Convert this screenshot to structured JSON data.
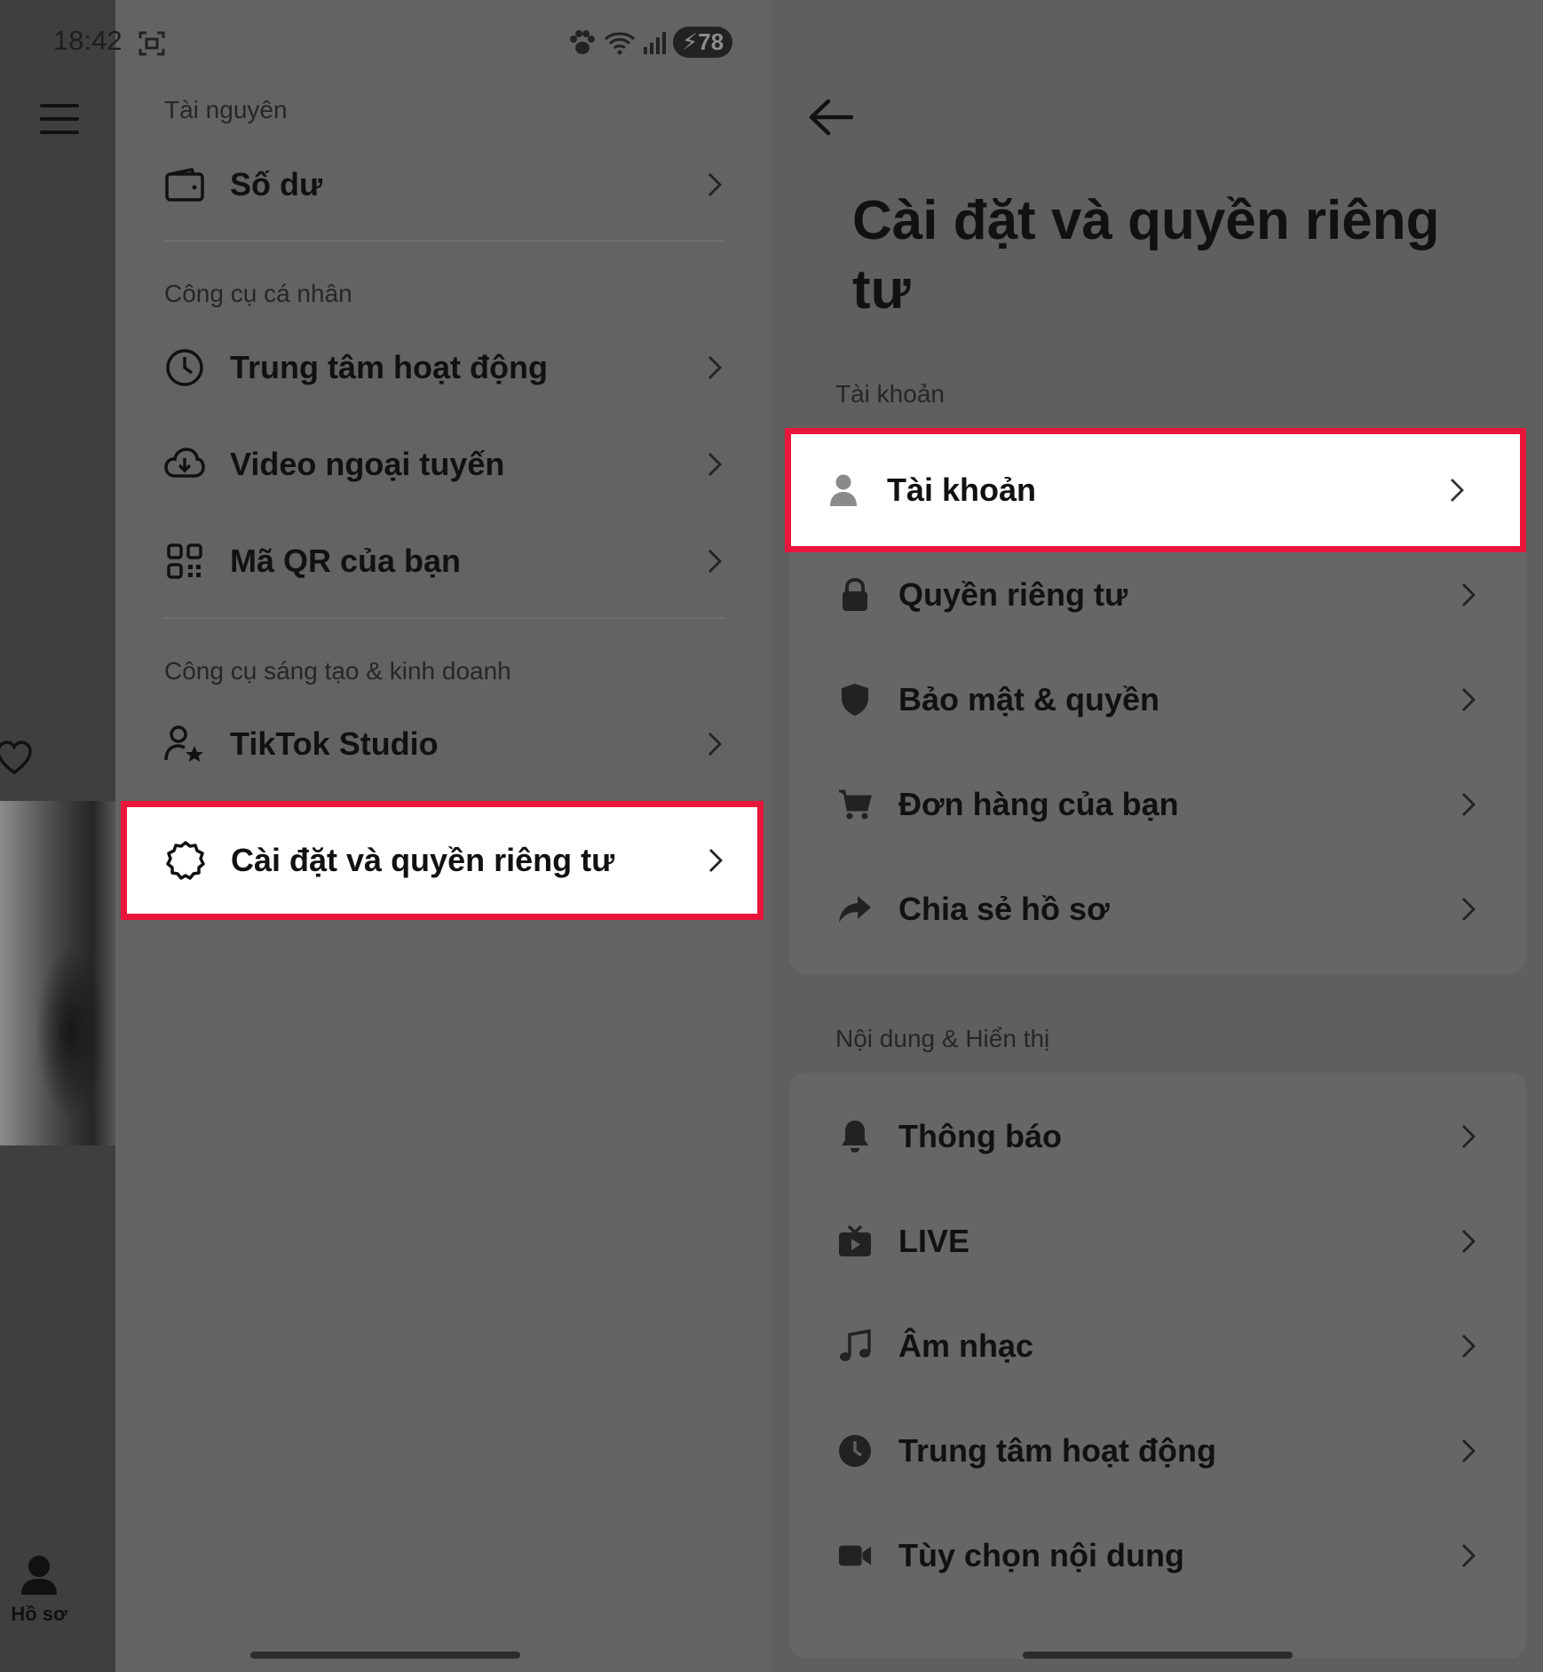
{
  "status_bar": {
    "time": "18:42",
    "battery": "78"
  },
  "left_screen": {
    "bottom_nav": {
      "profile_label": "Hồ sơ"
    },
    "sections": [
      {
        "header": "Tài nguyên",
        "items": [
          {
            "label": "Số dư",
            "icon": "wallet-icon"
          }
        ]
      },
      {
        "header": "Công cụ cá nhân",
        "items": [
          {
            "label": "Trung tâm hoạt động",
            "icon": "clock-icon"
          },
          {
            "label": "Video ngoại tuyến",
            "icon": "cloud-download-icon"
          },
          {
            "label": "Mã QR của bạn",
            "icon": "qr-code-icon"
          }
        ]
      },
      {
        "header": "Công cụ sáng tạo & kinh doanh",
        "items": [
          {
            "label": "TikTok Studio",
            "icon": "user-star-icon"
          },
          {
            "label": "Cài đặt và quyền riêng tư",
            "icon": "gear-icon"
          }
        ]
      }
    ]
  },
  "right_screen": {
    "title": "Cài đặt và quyền riêng tư",
    "sections": [
      {
        "header": "Tài khoản",
        "items": [
          {
            "label": "Tài khoản",
            "icon": "person-icon"
          },
          {
            "label": "Quyền riêng tư",
            "icon": "lock-icon"
          },
          {
            "label": "Bảo mật & quyền",
            "icon": "shield-icon"
          },
          {
            "label": "Đơn hàng của bạn",
            "icon": "cart-icon"
          },
          {
            "label": "Chia sẻ hồ sơ",
            "icon": "share-icon"
          }
        ]
      },
      {
        "header": "Nội dung & Hiển thị",
        "items": [
          {
            "label": "Thông báo",
            "icon": "bell-icon"
          },
          {
            "label": "LIVE",
            "icon": "tv-icon"
          },
          {
            "label": "Âm nhạc",
            "icon": "music-icon"
          },
          {
            "label": "Trung tâm hoạt động",
            "icon": "clock-icon"
          },
          {
            "label": "Tùy chọn nội dung",
            "icon": "video-camera-icon"
          }
        ]
      }
    ]
  },
  "colors": {
    "highlight_border": "#e8163a",
    "overlay_gray": "#636363",
    "text": "#111111"
  }
}
